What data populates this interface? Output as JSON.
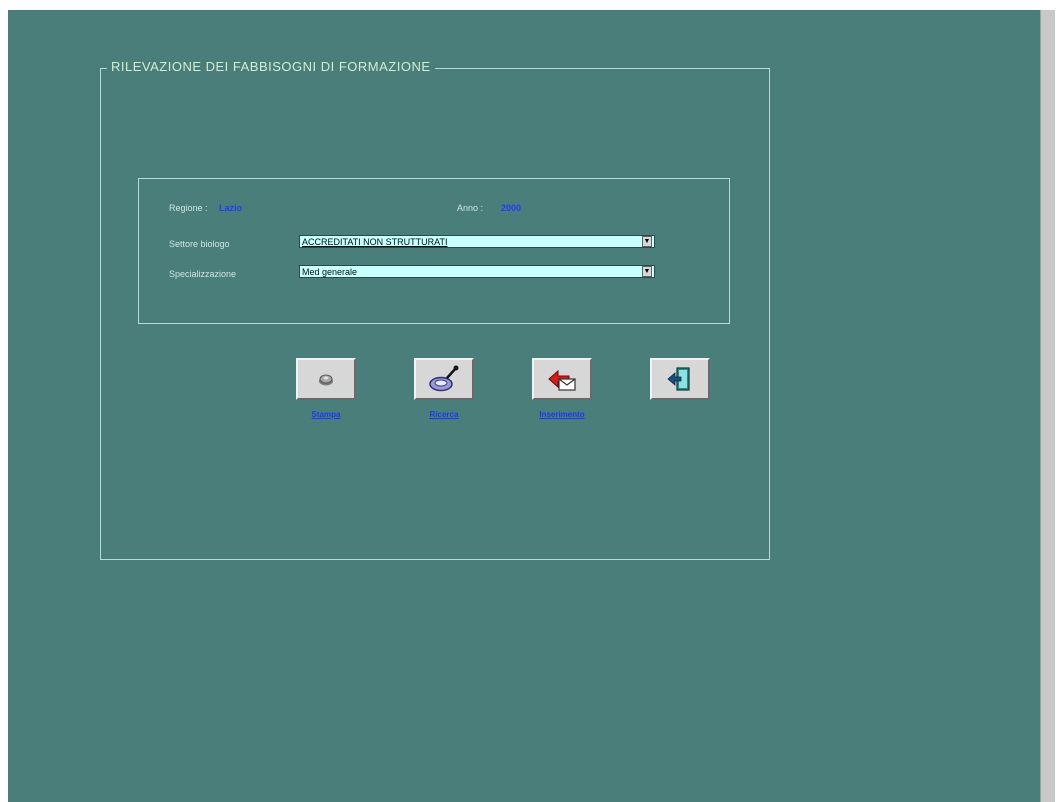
{
  "form": {
    "title": "RILEVAZIONE DEI FABBISOGNI DI FORMAZIONE"
  },
  "info": {
    "regione_label": "Regione :",
    "regione_value": "Lazio",
    "anno_label": "Anno :",
    "anno_value": "2000"
  },
  "fields": {
    "settore_label": "Settore biologo",
    "settore_value": "ACCREDITATI NON STRUTTURATI",
    "specializzazione_label": "Specializzazione",
    "specializzazione_value": "Med generale"
  },
  "buttons": [
    {
      "label": "Stampa",
      "icon": "printer-icon"
    },
    {
      "label": "Ricerca",
      "icon": "search-icon"
    },
    {
      "label": "Inserimento",
      "icon": "insert-icon"
    },
    {
      "label": "",
      "icon": "exit-icon"
    }
  ],
  "colors": {
    "background": "#4a7e7a",
    "field": "#c8ffff",
    "link": "#1838ff"
  }
}
